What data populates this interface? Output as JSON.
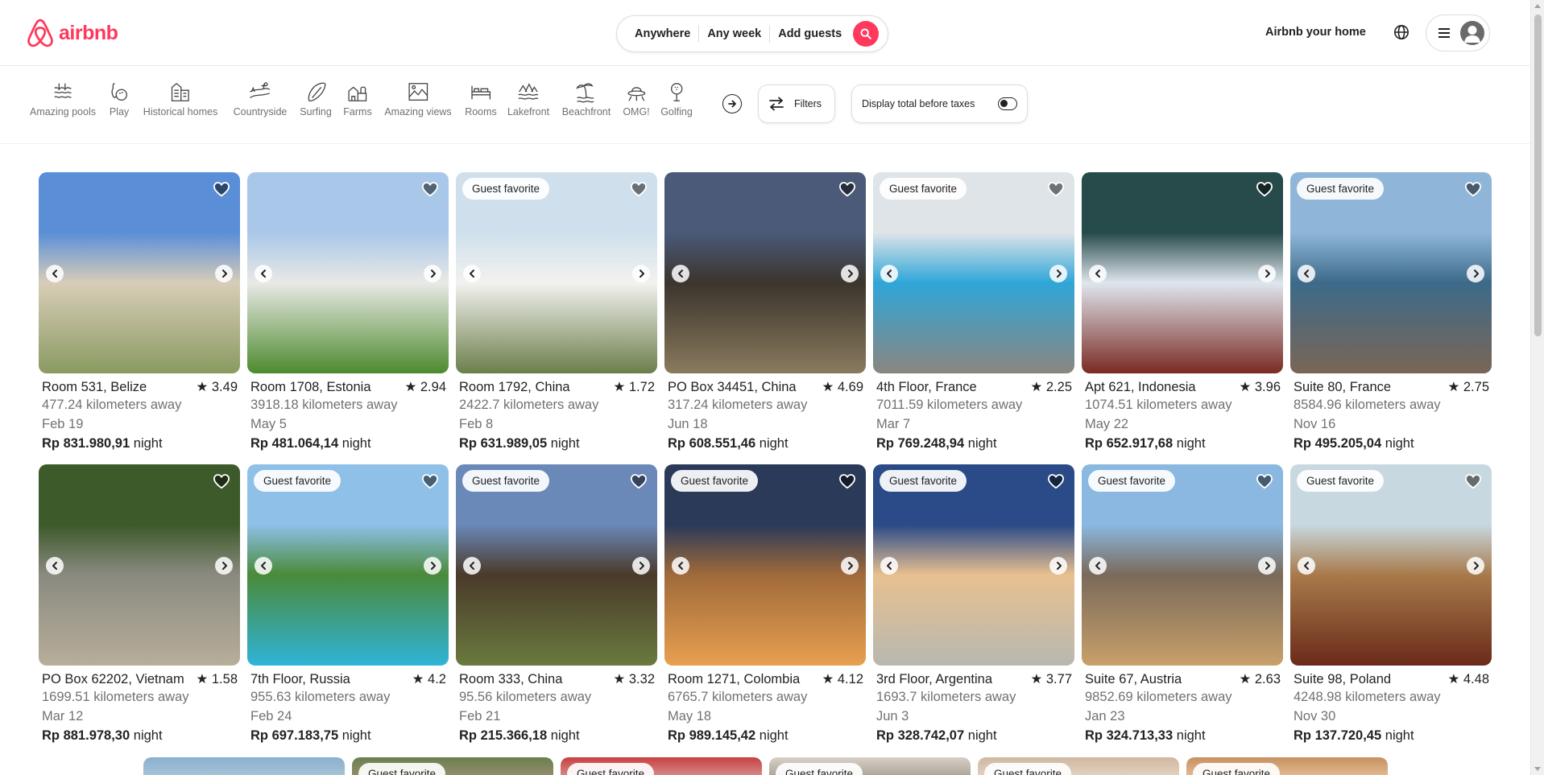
{
  "brand": {
    "name": "airbnb",
    "color": "#FF385C"
  },
  "search": {
    "where": "Anywhere",
    "when": "Any week",
    "who": "Add guests"
  },
  "header": {
    "host_link": "Airbnb your home"
  },
  "categories": [
    {
      "label": "Amazing pools",
      "icon": "pool-icon"
    },
    {
      "label": "Play",
      "icon": "bowling-icon"
    },
    {
      "label": "Historical homes",
      "icon": "historical-home-icon"
    },
    {
      "label": "Countryside",
      "icon": "countryside-icon"
    },
    {
      "label": "Surfing",
      "icon": "surfboard-icon"
    },
    {
      "label": "Farms",
      "icon": "farm-icon"
    },
    {
      "label": "Amazing views",
      "icon": "mountain-view-icon"
    },
    {
      "label": "Rooms",
      "icon": "bed-icon"
    },
    {
      "label": "Lakefront",
      "icon": "lake-icon"
    },
    {
      "label": "Beachfront",
      "icon": "beach-icon"
    },
    {
      "label": "OMG!",
      "icon": "ufo-icon"
    },
    {
      "label": "Golfing",
      "icon": "golf-icon"
    }
  ],
  "filters": {
    "label": "Filters"
  },
  "tax_toggle": {
    "label": "Display total before taxes",
    "on": false
  },
  "price_unit": "night",
  "badge_text": "Guest favorite",
  "listings": [
    {
      "title": "Room 531, Belize",
      "rating": "★ 3.49",
      "distance": "477.24 kilometers away",
      "date": "Feb 19",
      "price": "Rp 831.980,91",
      "favorite": false,
      "colors": [
        "#5a8fd8",
        "#d8cdb8",
        "#8a9a60"
      ]
    },
    {
      "title": "Room 1708, Estonia",
      "rating": "★ 2.94",
      "distance": "3918.18 kilometers away",
      "date": "May 5",
      "price": "Rp 481.064,14",
      "favorite": false,
      "colors": [
        "#a9c7e8",
        "#e9e9e6",
        "#4d8a2e"
      ]
    },
    {
      "title": "Room 1792, China",
      "rating": "★ 1.72",
      "distance": "2422.7 kilometers away",
      "date": "Feb 8",
      "price": "Rp 631.989,05",
      "favorite": true,
      "colors": [
        "#cfe0ec",
        "#f2f2ef",
        "#6b7e4a"
      ]
    },
    {
      "title": "PO Box 34451, China",
      "rating": "★ 4.69",
      "distance": "317.24 kilometers away",
      "date": "Jun 18",
      "price": "Rp 608.551,46",
      "favorite": false,
      "colors": [
        "#4a5a78",
        "#3b352d",
        "#8a7a5e"
      ]
    },
    {
      "title": "4th Floor, France",
      "rating": "★ 2.25",
      "distance": "7011.59 kilometers away",
      "date": "Mar 7",
      "price": "Rp 769.248,94",
      "favorite": true,
      "colors": [
        "#dfe4e8",
        "#2fa6d8",
        "#8a8680"
      ]
    },
    {
      "title": "Apt 621, Indonesia",
      "rating": "★ 3.96",
      "distance": "1074.51 kilometers away",
      "date": "May 22",
      "price": "Rp 652.917,68",
      "favorite": false,
      "colors": [
        "#274a4a",
        "#dfe6ee",
        "#7a2a22"
      ]
    },
    {
      "title": "Suite 80, France",
      "rating": "★ 2.75",
      "distance": "8584.96 kilometers away",
      "date": "Nov 16",
      "price": "Rp 495.205,04",
      "favorite": true,
      "colors": [
        "#8fb6d8",
        "#3d6a8a",
        "#7a6656"
      ]
    },
    {
      "title": "PO Box 62202, Vietnam",
      "rating": "★ 1.58",
      "distance": "1699.51 kilometers away",
      "date": "Mar 12",
      "price": "Rp 881.978,30",
      "favorite": false,
      "colors": [
        "#3d5a2a",
        "#8a8a80",
        "#b8ae9a"
      ]
    },
    {
      "title": "7th Floor, Russia",
      "rating": "★ 4.2",
      "distance": "955.63 kilometers away",
      "date": "Feb 24",
      "price": "Rp 697.183,75",
      "favorite": true,
      "colors": [
        "#8ec0e8",
        "#4a8a3a",
        "#2fb4d8"
      ]
    },
    {
      "title": "Room 333, China",
      "rating": "★ 3.32",
      "distance": "95.56 kilometers away",
      "date": "Feb 21",
      "price": "Rp 215.366,18",
      "favorite": true,
      "colors": [
        "#6a88b8",
        "#4a3a2a",
        "#6a7a3e"
      ]
    },
    {
      "title": "Room 1271, Colombia",
      "rating": "★ 4.12",
      "distance": "6765.7 kilometers away",
      "date": "May 18",
      "price": "Rp 989.145,42",
      "favorite": true,
      "colors": [
        "#2a3a58",
        "#a06a3a",
        "#e8a050"
      ]
    },
    {
      "title": "3rd Floor, Argentina",
      "rating": "★ 3.77",
      "distance": "1693.7 kilometers away",
      "date": "Jun 3",
      "price": "Rp 328.742,07",
      "favorite": true,
      "colors": [
        "#2a4a88",
        "#e8c090",
        "#b8b8b0"
      ]
    },
    {
      "title": "Suite 67, Austria",
      "rating": "★ 2.63",
      "distance": "9852.69 kilometers away",
      "date": "Jan 23",
      "price": "Rp 324.713,33",
      "favorite": true,
      "colors": [
        "#8ab8e0",
        "#7a6a5a",
        "#c8a06a"
      ]
    },
    {
      "title": "Suite 98, Poland",
      "rating": "★ 4.48",
      "distance": "4248.98 kilometers away",
      "date": "Nov 30",
      "price": "Rp 137.720,45",
      "favorite": true,
      "colors": [
        "#c8d8e0",
        "#a87a4a",
        "#6a2a1a"
      ]
    }
  ],
  "peek_rows": [
    {
      "colors": [
        "#8ab0d0",
        "#b0c8d8"
      ],
      "favorite": false
    },
    {
      "colors": [
        "#6a8050",
        "#a09070"
      ],
      "favorite": true
    },
    {
      "colors": [
        "#c84040",
        "#d8a0a0"
      ],
      "favorite": true
    },
    {
      "colors": [
        "#d8d0c8",
        "#a09888"
      ],
      "favorite": true
    },
    {
      "colors": [
        "#d0b8a0",
        "#e8d8c8"
      ],
      "favorite": true
    },
    {
      "colors": [
        "#c89060",
        "#e8c8a0"
      ],
      "favorite": true
    }
  ]
}
